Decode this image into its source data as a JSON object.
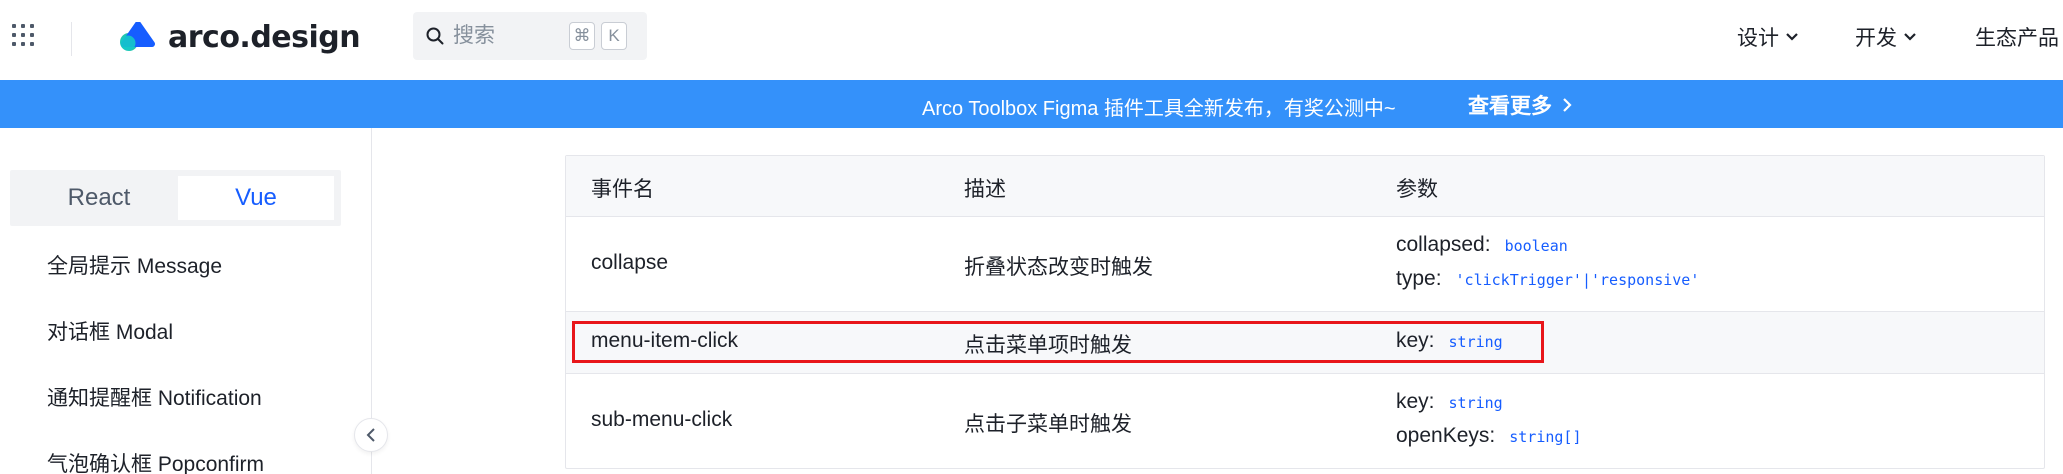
{
  "header": {
    "logo_text": "arco.design",
    "search": {
      "placeholder": "搜索",
      "shortcut_cmd": "⌘",
      "shortcut_key": "K"
    },
    "nav": [
      {
        "label": "设计"
      },
      {
        "label": "开发"
      },
      {
        "label": "生态产品"
      }
    ]
  },
  "banner": {
    "text": "Arco Toolbox Figma 插件工具全新发布，有奖公测中~",
    "link": "查看更多"
  },
  "sidebar": {
    "frameworks": {
      "react": "React",
      "vue": "Vue",
      "selected": "Vue"
    },
    "items": [
      {
        "label": "全局提示 Message"
      },
      {
        "label": "对话框 Modal"
      },
      {
        "label": "通知提醒框 Notification"
      },
      {
        "label": "气泡确认框 Popconfirm"
      }
    ]
  },
  "events_table": {
    "columns": [
      "事件名",
      "描述",
      "参数"
    ],
    "rows": [
      {
        "name": "collapse",
        "description": "折叠状态改变时触发",
        "params": [
          {
            "key": "collapsed:",
            "type": "boolean"
          },
          {
            "key": "type:",
            "type": "'clickTrigger'|'responsive'"
          }
        ]
      },
      {
        "name": "menu-item-click",
        "description": "点击菜单项时触发",
        "params": [
          {
            "key": "key:",
            "type": "string"
          }
        ]
      },
      {
        "name": "sub-menu-click",
        "description": "点击子菜单时触发",
        "params": [
          {
            "key": "key:",
            "type": "string"
          },
          {
            "key": "openKeys:",
            "type": "string[]"
          }
        ]
      }
    ]
  },
  "colors": {
    "banner": "#3491fa",
    "accent": "#165dff",
    "highlight_box": "#e8161a"
  }
}
